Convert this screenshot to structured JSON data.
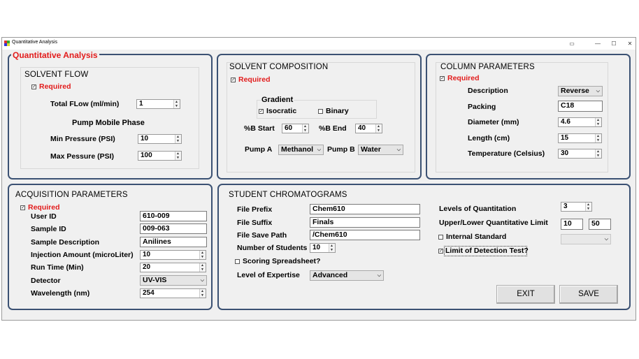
{
  "window": {
    "title": "Quantitative Analysis",
    "minimize": "—",
    "maximize": "☐",
    "close": "✕",
    "cast": "▭"
  },
  "main_title": "Quantitative Analysis",
  "solvent_flow": {
    "title": "SOLVENT FLOW",
    "required": "Required",
    "total_flow_label": "Total FLow (ml/min)",
    "total_flow": "1",
    "pump_phase_label": "Pump Mobile Phase",
    "min_pressure_label": "Min Pressure (PSI)",
    "min_pressure": "10",
    "max_pressure_label": "Max Pessure (PSI)",
    "max_pressure": "100"
  },
  "solvent_composition": {
    "title": "SOLVENT COMPOSITION",
    "required": "Required",
    "gradient_label": "Gradient",
    "isocratic": "Isocratic",
    "binary": "Binary",
    "b_start_label": "%B Start",
    "b_start": "60",
    "b_end_label": "%B End",
    "b_end": "40",
    "pump_a_label": "Pump A",
    "pump_a": "Methanol",
    "pump_b_label": "Pump B",
    "pump_b": "Water"
  },
  "column": {
    "title": "COLUMN PARAMETERS",
    "required": "Required",
    "description_label": "Description",
    "description": "Reverse",
    "packing_label": "Packing",
    "packing": "C18",
    "diameter_label": "Diameter (mm)",
    "diameter": "4.6",
    "length_label": "Length (cm)",
    "length": "15",
    "temperature_label": "Temperature (Celsius)",
    "temperature": "30"
  },
  "acquisition": {
    "title": "ACQUISITION PARAMETERS",
    "required": "Required",
    "user_id_label": "User ID",
    "user_id": "610-009",
    "sample_id_label": "Sample ID",
    "sample_id": "009-063",
    "sample_desc_label": "Sample Description",
    "sample_desc": "Anilines",
    "injection_label": "Injection Amount (microLiter)",
    "injection": "10",
    "run_time_label": "Run Time (Min)",
    "run_time": "20",
    "detector_label": "Detector",
    "detector": "UV-VIS",
    "wavelength_label": "Wavelength (nm)",
    "wavelength": "254"
  },
  "chromatograms": {
    "title": "STUDENT CHROMATOGRAMS",
    "file_prefix_label": "File Prefix",
    "file_prefix": "Chem610",
    "file_suffix_label": "File Suffix",
    "file_suffix": "Finals",
    "save_path_label": "File Save Path",
    "save_path": "/Chem610",
    "num_students_label": "Number of Students",
    "num_students": "10",
    "scoring_label": "Scoring Spreadsheet?",
    "expertise_label": "Level of Expertise",
    "expertise": "Advanced",
    "levels_label": "Levels of Quantitation",
    "levels": "3",
    "limit_label": "Upper/Lower Quantitative Limit",
    "upper_limit": "10",
    "lower_limit": "50",
    "internal_std_label": "Internal Standard",
    "lod_label": "Limit of Detection Test?",
    "exit": "EXIT",
    "save": "SAVE"
  }
}
